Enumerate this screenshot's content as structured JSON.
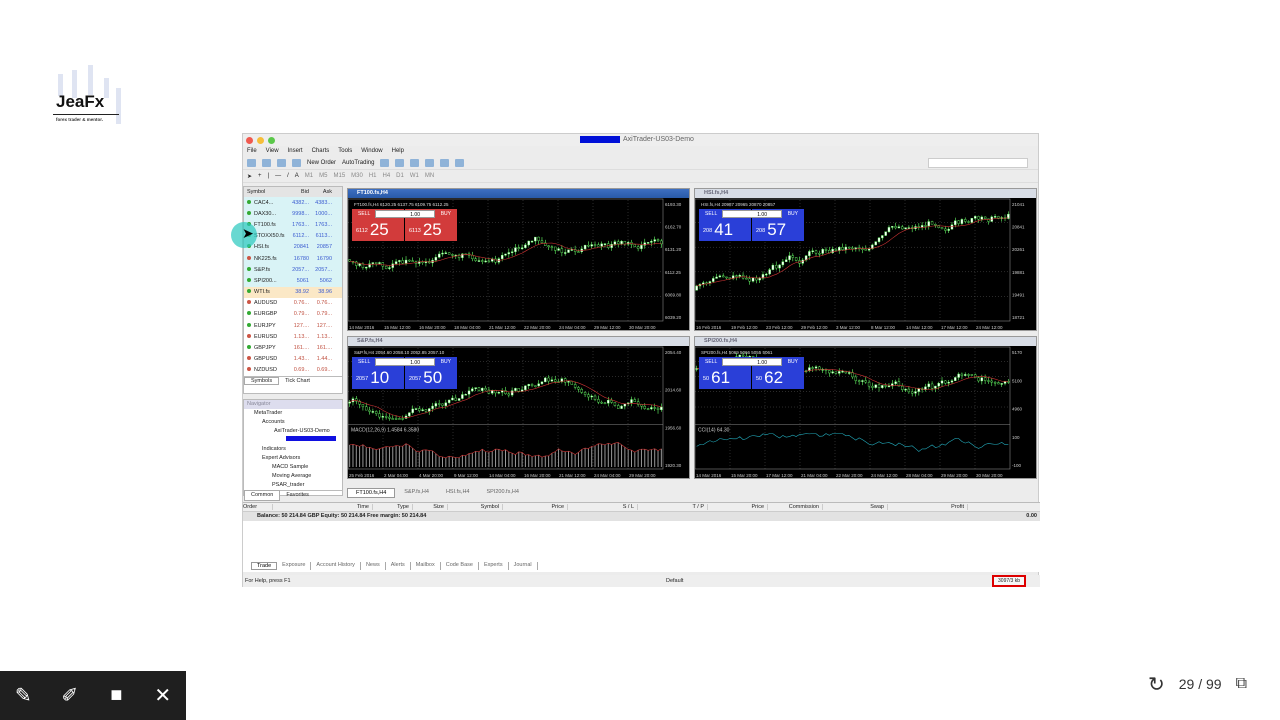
{
  "logo": {
    "name": "JeaFx",
    "tagline": "forex trader & mentor."
  },
  "window": {
    "title": "AxiTrader-US03-Demo",
    "menu": [
      "File",
      "View",
      "Insert",
      "Charts",
      "Tools",
      "Window",
      "Help"
    ],
    "toolbar": {
      "new_order": "New Order",
      "autotrading": "AutoTrading",
      "timeframes": [
        "M1",
        "M5",
        "M15",
        "M30",
        "H1",
        "H4",
        "D1",
        "W1",
        "MN"
      ]
    }
  },
  "market_watch": {
    "title": "Market Watch: 15:00:11",
    "columns": [
      "Symbol",
      "Bid",
      "Ask"
    ],
    "rows": [
      [
        "CAC4...",
        "4382...",
        "4383...",
        "up",
        ""
      ],
      [
        "DAX30...",
        "9998...",
        "1000...",
        "up",
        ""
      ],
      [
        "FT100.fs",
        "1763...",
        "1763...",
        "up",
        ""
      ],
      [
        "STOXX50.fs",
        "6112...",
        "6113...",
        "up",
        ""
      ],
      [
        "HSI.fs",
        "20841",
        "20857",
        "up",
        ""
      ],
      [
        "NK225.fs",
        "16780",
        "16790",
        "down",
        ""
      ],
      [
        "S&P.fs",
        "2057...",
        "2057...",
        "up",
        ""
      ],
      [
        "SPI200...",
        "5061",
        "5062",
        "up",
        ""
      ],
      [
        "WTI.fs",
        "38.92",
        "38.96",
        "up",
        "y"
      ],
      [
        "AUDUSD",
        "0.76...",
        "0.76...",
        "down",
        "w"
      ],
      [
        "EURGBP",
        "0.79...",
        "0.79...",
        "up",
        "w"
      ],
      [
        "EURJPY",
        "127....",
        "127....",
        "up",
        "w"
      ],
      [
        "EURUSD",
        "1.13...",
        "1.13...",
        "down",
        "w"
      ],
      [
        "GBPJPY",
        "161....",
        "161....",
        "up",
        "w"
      ],
      [
        "GBPUSD",
        "1.43...",
        "1.44...",
        "down",
        "w"
      ],
      [
        "NZDUSD",
        "0.69...",
        "0.69...",
        "down",
        "w"
      ]
    ],
    "tabs": [
      "Symbols",
      "Tick Chart"
    ]
  },
  "navigator": {
    "title": "Navigator",
    "items": [
      "MetaTrader",
      "Accounts",
      "AxiTrader-US03-Demo",
      "Indicators",
      "Expert Advisors",
      "MACD Sample",
      "Moving Average",
      "PSAR_trader"
    ],
    "tabs": [
      "Common",
      "Favorites"
    ]
  },
  "charts": [
    {
      "title": "FT100.fs,H4",
      "info": "FT100.fs,H4  6120.25 6137.75 6109.75 6112.25",
      "sell_label": "SELL",
      "buy_label": "BUY",
      "lot": "1.00",
      "sell_pre": "6112",
      "sell_big": "25",
      "buy_pre": "6113",
      "buy_big": "25",
      "color": "red",
      "prices": [
        "6193.30",
        "6162.70",
        "6131.20",
        "6112.25",
        "6069.80",
        "6039.20"
      ],
      "dates": [
        "14 Mar 2016",
        "15 Mar 12:00",
        "16 Mar 20:00",
        "18 Mar 04:00",
        "21 Mar 12:00",
        "22 Mar 20:00",
        "24 Mar 04:00",
        "29 Mar 12:00",
        "30 Mar 20:00"
      ],
      "seed": 3,
      "trend": 0
    },
    {
      "title": "HSI.fs,H4",
      "info": "HSI.fs,H4  20987 20965 20870 20857",
      "sell_label": "SELL",
      "buy_label": "BUY",
      "lot": "1.00",
      "sell_pre": "208",
      "sell_big": "41",
      "buy_pre": "208",
      "buy_big": "57",
      "color": "blue",
      "prices": [
        "21041",
        "20841",
        "20261",
        "19881",
        "19491",
        "18721"
      ],
      "dates": [
        "16 Feb 2016",
        "19 Feb 12:00",
        "23 Feb 12:00",
        "29 Feb 12:00",
        "3 Mar 12:00",
        "8 Mar 12:00",
        "14 Mar 12:00",
        "17 Mar 12:00",
        "24 Mar 12:00"
      ],
      "seed": 7,
      "trend": 1
    },
    {
      "title": "S&P.fs,H4",
      "info": "S&P.fs,H4  2054.60 2058.10 2052.85 2057.10",
      "sell_label": "SELL",
      "buy_label": "BUY",
      "lot": "1.00",
      "sell_pre": "2057",
      "sell_big": "10",
      "buy_pre": "2057",
      "buy_big": "50",
      "color": "blue",
      "indicator": "MACD(12,26,9) 1.4584 6.3580",
      "prices": [
        "2054.40",
        "2014.60",
        "1956.60",
        "1920.30"
      ],
      "dates": [
        "25 Feb 2016",
        "2 Mar 04:00",
        "4 Mar 20:00",
        "9 Mar 12:00",
        "14 Mar 04:00",
        "16 Mar 20:00",
        "21 Mar 12:00",
        "24 Mar 04:00",
        "29 Mar 20:00"
      ],
      "seed": 11,
      "trend": 1
    },
    {
      "title": "SPI200.fs,H4",
      "info": "SPI200.fs,H4  5069 5066 5055 5061",
      "sell_label": "SELL",
      "buy_label": "BUY",
      "lot": "1.00",
      "sell_pre": "50",
      "sell_big": "61",
      "buy_pre": "50",
      "buy_big": "62",
      "color": "blue",
      "indicator": "CCI(14) 64.30",
      "prices": [
        "5170",
        "5100",
        "4960",
        "100",
        "-100"
      ],
      "dates": [
        "14 Mar 2016",
        "15 Mar 20:00",
        "17 Mar 12:00",
        "21 Mar 04:00",
        "22 Mar 20:00",
        "24 Mar 12:00",
        "28 Mar 04:00",
        "29 Mar 20:00",
        "30 Mar 20:00"
      ],
      "seed": 5,
      "trend": -1
    }
  ],
  "chart_tabs": [
    "FT100.fs,H4",
    "S&P.fs,H4",
    "HSI.fs,H4",
    "SPI200.fs,H4"
  ],
  "terminal": {
    "columns": [
      "Order",
      "Time",
      "Type",
      "Size",
      "Symbol",
      "Price",
      "S / L",
      "T / P",
      "Price",
      "Commission",
      "Swap",
      "Profit"
    ],
    "balance": "Balance: 50 214.84 GBP  Equity: 50 214.84  Free margin: 50 214.84",
    "profit": "0.00",
    "tabs": [
      "Trade",
      "Exposure",
      "Account History",
      "News",
      "Alerts",
      "Mailbox",
      "Code Base",
      "Experts",
      "Journal"
    ]
  },
  "status": {
    "help": "For Help, press F1",
    "profile": "Default",
    "traffic": "3097/3 kb"
  },
  "slide": {
    "page": "29 / 99"
  }
}
